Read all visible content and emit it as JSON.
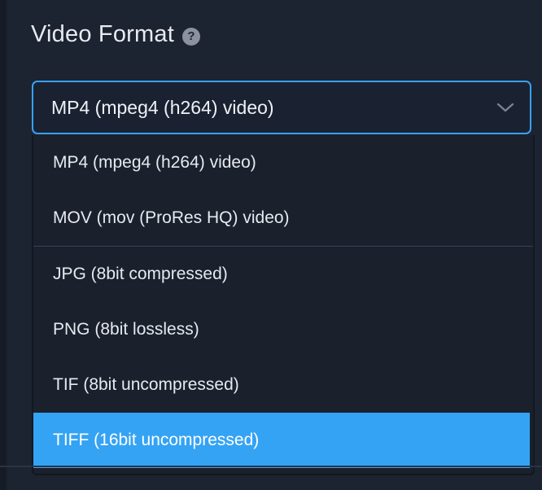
{
  "section": {
    "title": "Video Format",
    "help_icon": "question-circle-icon"
  },
  "select": {
    "value": "MP4 (mpeg4 (h264) video)",
    "chevron_icon": "chevron-down-icon",
    "accent_color": "#3aa0f5"
  },
  "dropdown": {
    "groups": [
      {
        "options": [
          {
            "label": "MP4 (mpeg4 (h264) video)"
          },
          {
            "label": "MOV (mov (ProRes HQ) video)"
          }
        ]
      },
      {
        "options": [
          {
            "label": "JPG (8bit compressed)"
          },
          {
            "label": "PNG (8bit lossless)"
          },
          {
            "label": "TIF (8bit uncompressed)"
          },
          {
            "label": "TIFF (16bit uncompressed)"
          }
        ]
      }
    ],
    "highlighted_option": "TIFF (16bit uncompressed)",
    "highlight_color": "#34a3f4"
  }
}
